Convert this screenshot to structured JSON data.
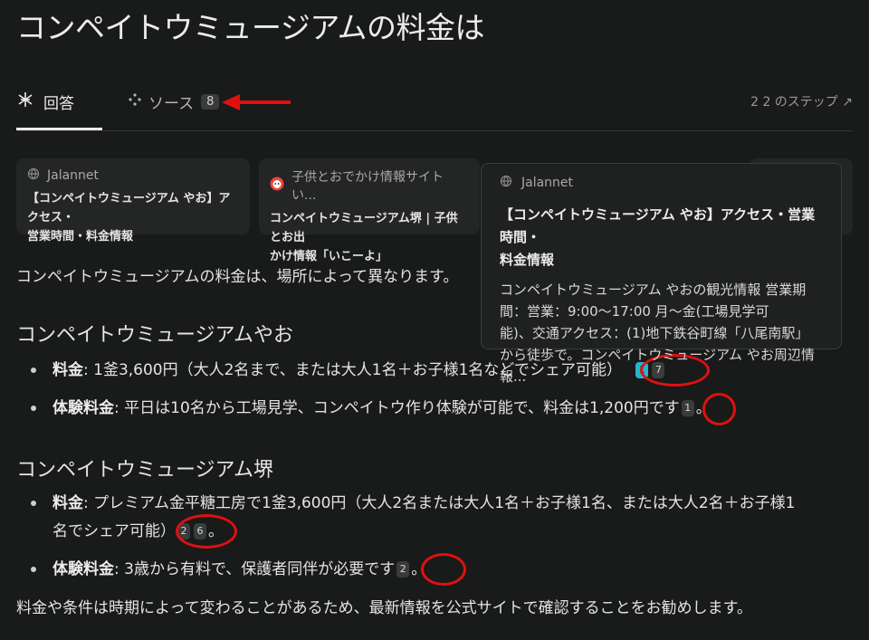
{
  "title": "コンペイトウミュージアムの料金は",
  "tabs": {
    "answer_label": "回答",
    "sources_label": "ソース",
    "sources_count": "8",
    "steps_label": "2 2 のステップ ↗"
  },
  "source_cards": [
    {
      "source": "Jalannet",
      "title_line1": "【コンペイトウミュージアム やお】アクセス・",
      "title_line2": "営業時間・料金情報"
    },
    {
      "source": "子供とおでかけ情報サイト い...",
      "title_line1": "コンペイトウミュージアム堺 | 子供とお出",
      "title_line2": "かけ情報「いこーよ」"
    }
  ],
  "popup": {
    "source": "Jalannet",
    "title_line1": "【コンペイトウミュージアム やお】アクセス・営業時間・",
    "title_line2": "料金情報",
    "body_line1": "コンペイトウミュージアム やおの観光情報 営業期",
    "body_line2": "間：営業：9:00～17:00 月～金(工場見学可",
    "body_line3": "能)、交通アクセス：(1)地下鉄谷町線「八尾南駅」",
    "body_line4": "から徒歩で。コンペイトウミュージアム やお周辺情報..."
  },
  "answer": {
    "intro": "コンペイトウミュージアムの料金は、場所によって異なります。",
    "section1_heading": "コンペイトウミュージアムやお",
    "s1_b1_label": "料金",
    "s1_b1_text": ": 1釜3,600円（大人2名まで、または大人1名＋お子様1名などでシェア可能）",
    "s1_b1_cites": [
      "1",
      "7"
    ],
    "s1_b2_label": "体験料金",
    "s1_b2_text": ": 平日は10名から工場見学、コンペイトウ作り体験が可能で、料金は1,200円です",
    "s1_b2_cites": [
      "1"
    ],
    "section2_heading": "コンペイトウミュージアム堺",
    "s2_b1_label": "料金",
    "s2_b1_text_line1": ": プレミアム金平糖工房で1釜3,600円（大人2名または大人1名＋お子様1名、または大人2名＋お子様1",
    "s2_b1_text_line2": "名でシェア可能）",
    "s2_b1_cites": [
      "2",
      "6"
    ],
    "s2_b2_label": "体験料金",
    "s2_b2_text": ": 3歳から有料で、保護者同伴が必要です",
    "s2_b2_cites": [
      "2"
    ],
    "period": "。",
    "outro": "料金や条件は時期によって変わることがあるため、最新情報を公式サイトで確認することをお勧めします。"
  }
}
